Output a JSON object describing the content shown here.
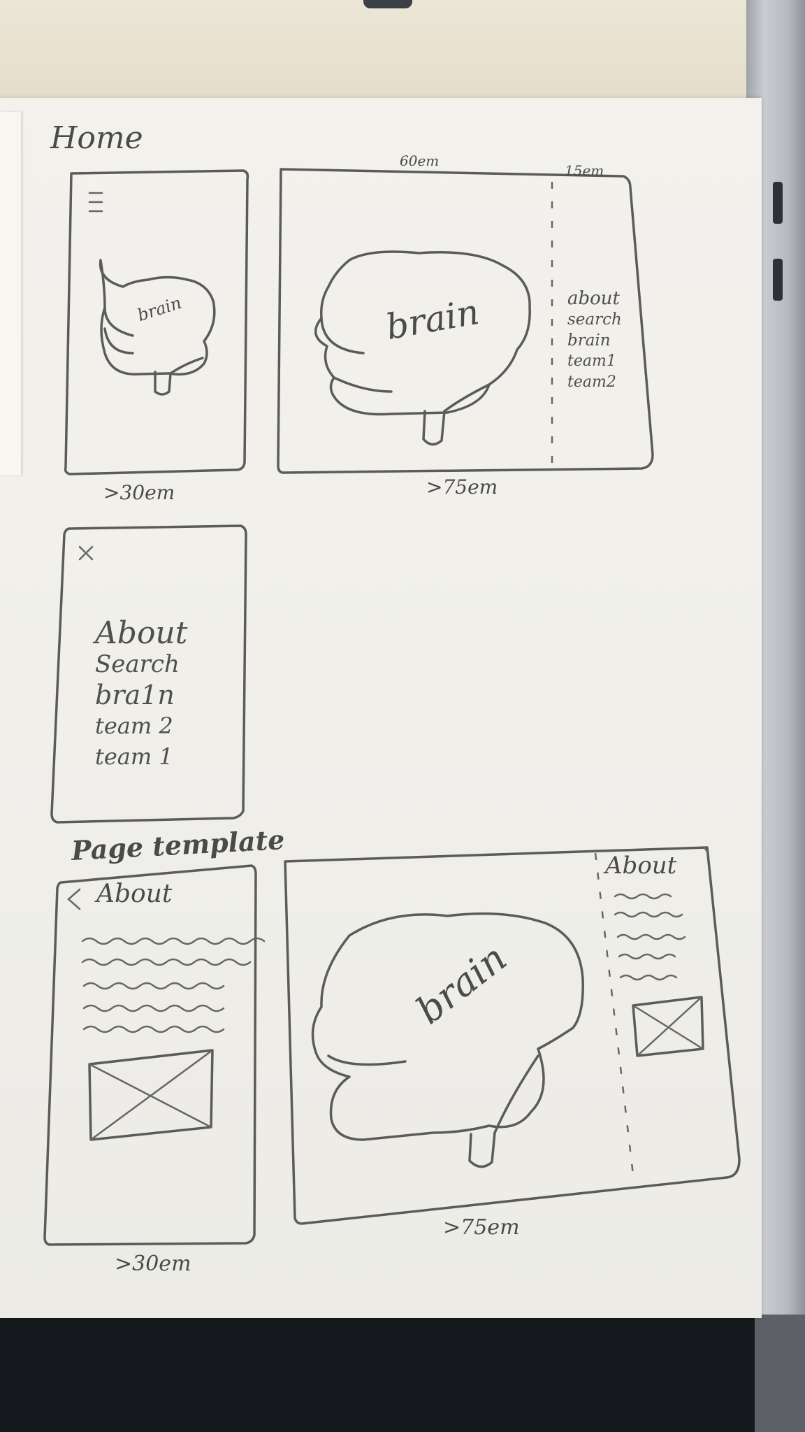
{
  "headings": {
    "home": "Home",
    "page_template": "Page template"
  },
  "dimensions": {
    "width_60": "60em",
    "width_15": "15em",
    "small": ">30em",
    "large": ">75em"
  },
  "home": {
    "hamburger_icon": "hamburger-icon",
    "brain_label": "brain",
    "desktop_menu": [
      "about",
      "search",
      "brain",
      "team1",
      "team2"
    ]
  },
  "mobile_menu": {
    "close_icon": "close-icon",
    "items": [
      "About",
      "Search",
      "bra1n",
      "team 2",
      "team 1"
    ]
  },
  "page_template": {
    "back_icon": "chevron-left-icon",
    "mobile_title": "About",
    "brain_label": "brain",
    "desktop_sidebar_title": "About",
    "image_placeholder_icon": "image-placeholder-icon"
  }
}
